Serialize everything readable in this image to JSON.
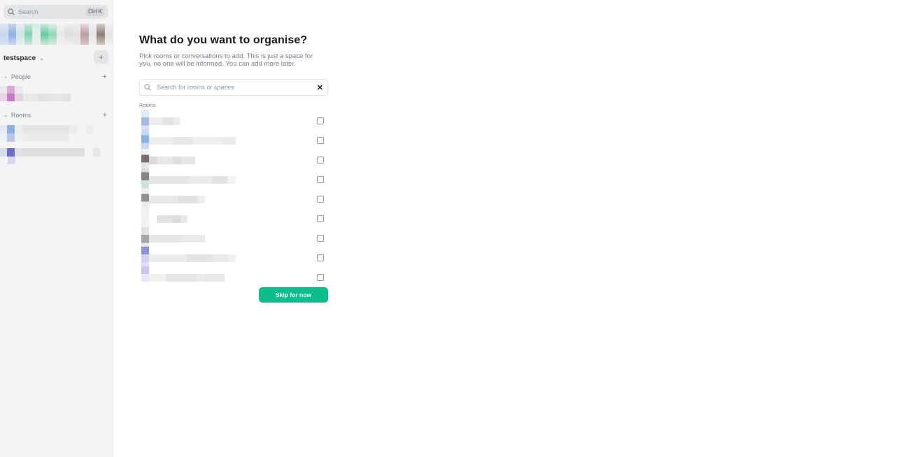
{
  "sidebar": {
    "search_label": "Search",
    "search_shortcut": "Ctrl K",
    "space_name": "testspace",
    "sections": {
      "people": "People",
      "rooms": "Rooms"
    }
  },
  "dialog": {
    "title": "What do you want to organise?",
    "subtitle": "Pick rooms or conversations to add. This is just a space for you, no one will be informed. You can add more later.",
    "search_placeholder": "Search for rooms or spaces",
    "rooms_heading": "Rooms",
    "skip_button": "Skip for now"
  },
  "colors": {
    "accent": "#0dbd8b",
    "sidebar_bg": "#f4f4f4",
    "muted_text": "#737d8c"
  },
  "icons": [
    "search-icon",
    "chevron-down-icon",
    "plus-icon",
    "caret-down-icon",
    "close-icon"
  ]
}
